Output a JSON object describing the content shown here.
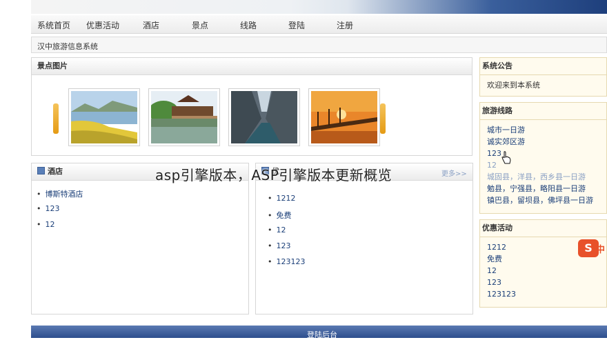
{
  "nav": {
    "items": [
      "系统首页",
      "优惠活动",
      "酒店",
      "景点",
      "线路",
      "登陆",
      "注册"
    ]
  },
  "site": {
    "title": "汉中旅游信息系统"
  },
  "scenic": {
    "title": "景点图片"
  },
  "hotel": {
    "title": "酒店",
    "items": [
      "博斯特酒店",
      "123",
      "12"
    ]
  },
  "middle": {
    "title": "优",
    "more": "更多>>",
    "items": [
      "1212",
      "免费",
      "12",
      "123",
      "123123"
    ]
  },
  "notice": {
    "title": "系统公告",
    "text": "欢迎来到本系统"
  },
  "routes": {
    "title": "旅游线路",
    "items": [
      "城市一日游",
      "诚实郊区游",
      "123",
      "12",
      "城固县，洋县，西乡县一日游",
      "勉县，宁强县，略阳县一日游",
      "镇巴县，留坝县，佛坪县一日游"
    ]
  },
  "promo": {
    "title": "优惠活动",
    "items": [
      "1212",
      "免费",
      "12",
      "123",
      "123123"
    ],
    "badge": "S",
    "badge_text": "中"
  },
  "footer": {
    "label": "登陆后台"
  },
  "overlay": {
    "caption": "asp引擎版本，ASP引擎版本更新概览"
  },
  "colors": {
    "accent": "#2d4e8d",
    "link": "#1a3e78",
    "arrow": "#e59b14",
    "badge": "#e8512a"
  }
}
